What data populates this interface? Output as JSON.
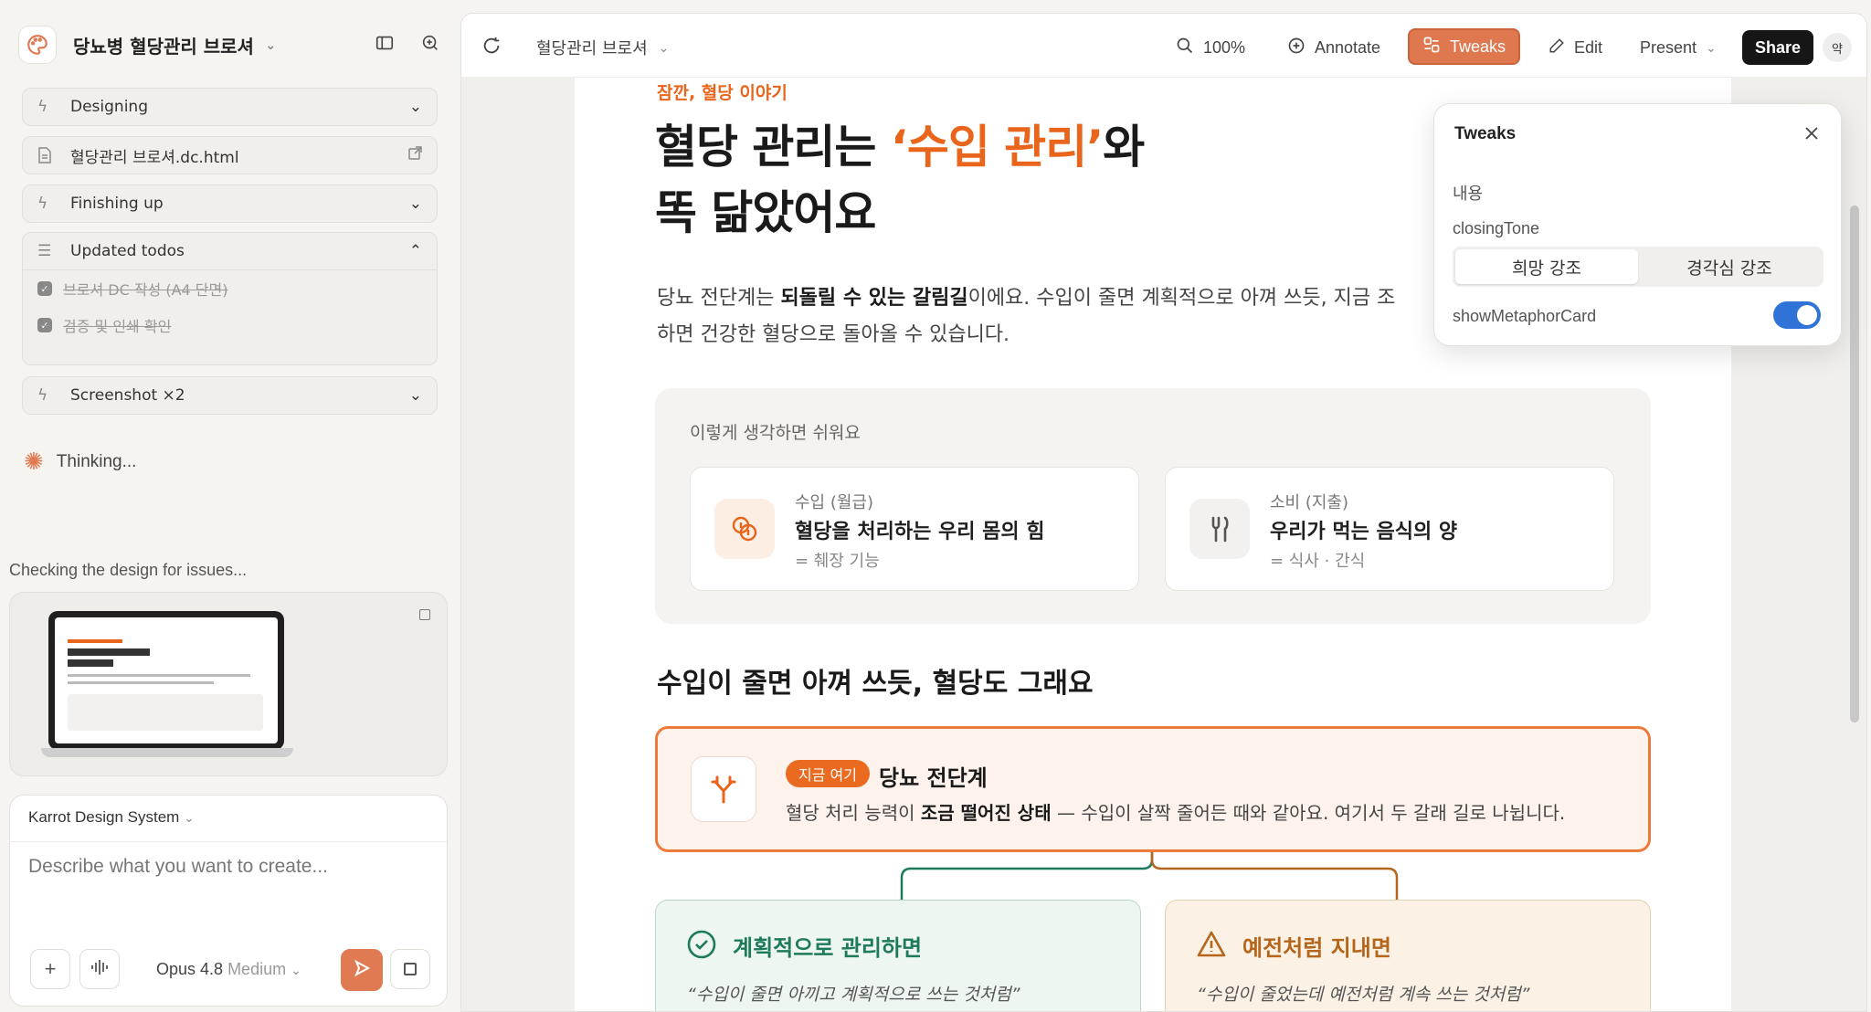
{
  "sidebar": {
    "project_title": "당뇨병 혈당관리 브로셔",
    "steps": {
      "designing": "Designing",
      "file": "혈당관리 브로셔.dc.html",
      "finishing": "Finishing up",
      "todos": "Updated todos",
      "todo_items": [
        "브로셔 DC 작성 (A4 단면)",
        "검증 및 인쇄 확인"
      ],
      "screenshot": "Screenshot ×2"
    },
    "thinking": "Thinking...",
    "checking": "Checking the design for issues..."
  },
  "composer": {
    "design_system": "Karrot Design System",
    "placeholder": "Describe what you want to create...",
    "model": "Opus 4.8",
    "effort": "Medium"
  },
  "toolbar": {
    "doc_title": "혈당관리 브로셔",
    "zoom": "100%",
    "annotate": "Annotate",
    "tweaks": "Tweaks",
    "edit": "Edit",
    "present": "Present",
    "share": "Share",
    "avatar": "약"
  },
  "page": {
    "kicker": "잠깐, 혈당 이야기",
    "title_a": "혈당 관리는 ",
    "title_accent": "‘수입 관리’",
    "title_b": "와",
    "title_c": "똑 닮았어요",
    "lead_a": "당뇨 전단계는 ",
    "lead_bold": "되돌릴 수 있는 갈림길",
    "lead_b": "이에요. 수입이 줄면 계획적으로 아껴 쓰듯, 지금 조",
    "lead_c": "하면 건강한 혈당으로 돌아올 수 있습니다.",
    "metaphor_title": "이렇게 생각하면 쉬워요",
    "income": {
      "sub": "수입 (월급)",
      "main": "혈당을 처리하는 우리 몸의 힘",
      "note": "= 췌장 기능"
    },
    "spending": {
      "sub": "소비 (지출)",
      "main": "우리가 먹는 음식의 양",
      "note": "= 식사 · 간식"
    },
    "section_title": "수입이 줄면 아껴 쓰듯, 혈당도 그래요",
    "stage_badge": "지금 여기",
    "stage_title": "당뇨 전단계",
    "stage_desc_a": "혈당 처리 능력이 ",
    "stage_desc_bold": "조금 떨어진 상태",
    "stage_desc_b": " — 수입이 살짝 줄어든 때와 같아요. 여기서 두 갈래 길로 나뉩니다.",
    "good_title": "계획적으로 관리하면",
    "good_quote": "“수입이 줄면 아끼고 계획적으로 쓰는 것처럼”",
    "bad_title": "예전처럼 지내면",
    "bad_quote": "“수입이 줄었는데 예전처럼 계속 쓰는 것처럼”"
  },
  "tweaks": {
    "title": "Tweaks",
    "section": "내용",
    "closing_label": "closingTone",
    "options": [
      "희망 강조",
      "경각심 강조"
    ],
    "selected": "희망 강조",
    "metaphor_label": "showMetaphorCard",
    "metaphor_on": true
  },
  "colors": {
    "accent": "#e8651b",
    "tweaks_button": "#e0784f",
    "toggle": "#2f73d8",
    "good": "#1d7a5a",
    "bad": "#b5661c"
  }
}
